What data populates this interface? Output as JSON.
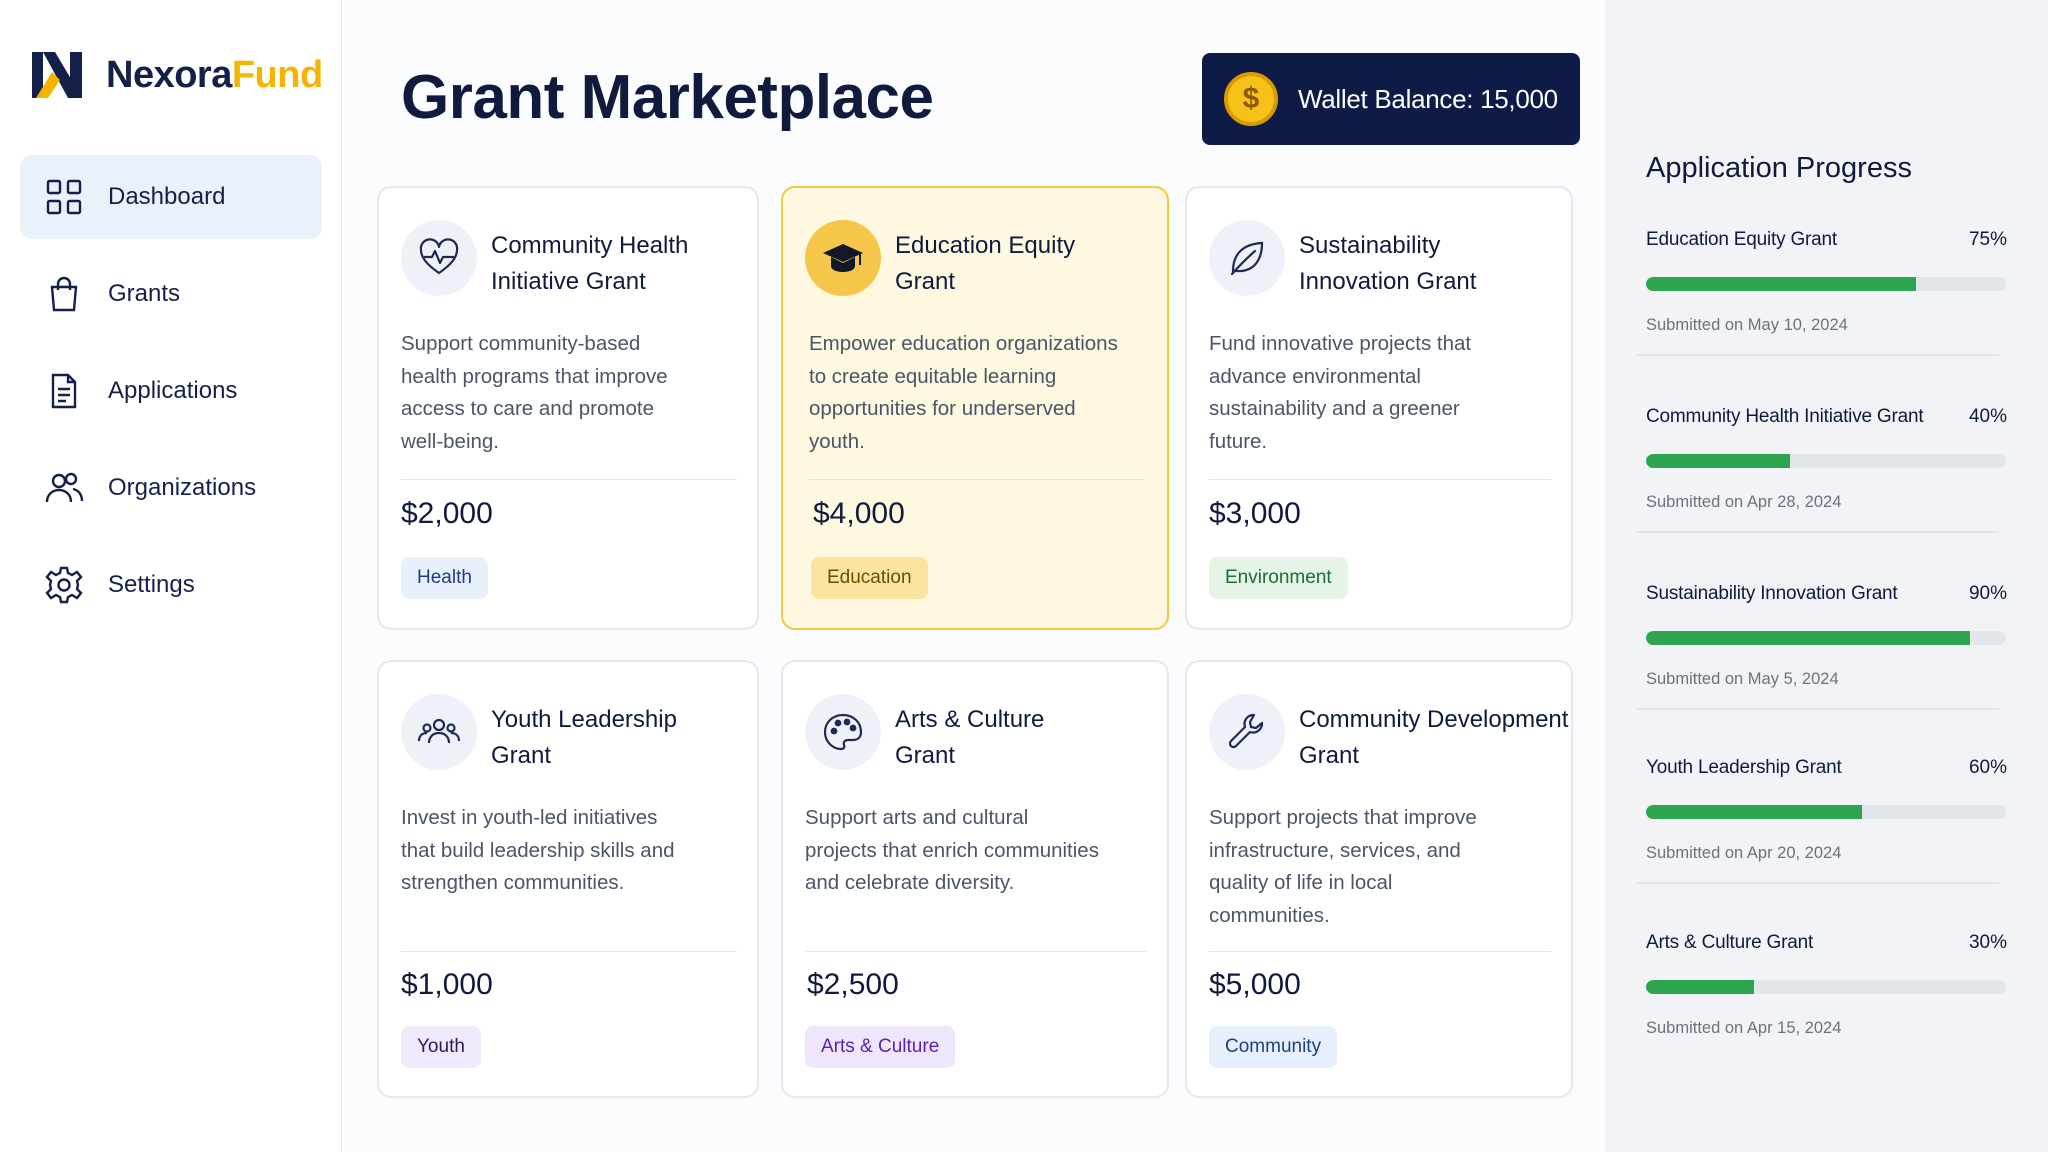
{
  "brand": {
    "name_part1": "Nexora",
    "name_part2": "Fund",
    "accent": "#f5b400",
    "primary": "#13204a"
  },
  "nav": [
    {
      "label": "Dashboard",
      "icon": "grid-icon",
      "active": true
    },
    {
      "label": "Grants",
      "icon": "shopping-bag-icon",
      "active": false
    },
    {
      "label": "Applications",
      "icon": "document-icon",
      "active": false
    },
    {
      "label": "Organizations",
      "icon": "users-icon",
      "active": false
    },
    {
      "label": "Settings",
      "icon": "gear-icon",
      "active": false
    }
  ],
  "header": {
    "title": "Grant Marketplace"
  },
  "wallet": {
    "coin_symbol": "$",
    "label": "Wallet Balance: 15,000"
  },
  "grants": [
    {
      "title_line1": "Community Health",
      "title_line2": "Initiative Grant",
      "icon": "heart-pulse-icon",
      "desc": [
        "Support community-based",
        "health programs that improve",
        "access to care and promote",
        "well-being."
      ],
      "amount": "$2,000",
      "tag": "Health",
      "tag_bg": "#e8f0fc",
      "tag_fg": "#1e3a8a",
      "featured": false
    },
    {
      "title_line1": "Education Equity",
      "title_line2": "Grant",
      "icon": "graduation-cap-icon",
      "desc": [
        "Empower education organizations",
        "to create equitable learning",
        "opportunities for underserved",
        "youth."
      ],
      "amount": "$4,000",
      "tag": "Education",
      "tag_bg": "#fbe6a6",
      "tag_fg": "#6b4e00",
      "featured": true
    },
    {
      "title_line1": "Sustainability",
      "title_line2": "Innovation Grant",
      "icon": "leaf-icon",
      "desc": [
        "Fund innovative projects that",
        "advance environmental",
        "sustainability and a greener",
        "future."
      ],
      "amount": "$3,000",
      "tag": "Environment",
      "tag_bg": "#e4f5e7",
      "tag_fg": "#1f6b33",
      "featured": false
    },
    {
      "title_line1": "Youth Leadership",
      "title_line2": "Grant",
      "icon": "group-icon",
      "desc": [
        "Invest in youth-led initiatives",
        "that build leadership skills and",
        "strengthen communities."
      ],
      "amount": "$1,000",
      "tag": "Youth",
      "tag_bg": "#efe9fb",
      "tag_fg": "#2b1d57",
      "featured": false
    },
    {
      "title_line1": "Arts & Culture",
      "title_line2": "Grant",
      "icon": "palette-icon",
      "desc": [
        "Support arts and cultural",
        "projects that enrich communities",
        "and celebrate diversity."
      ],
      "amount": "$2,500",
      "tag": "Arts & Culture",
      "tag_bg": "#f0e6fb",
      "tag_fg": "#5b21b6",
      "featured": false
    },
    {
      "title_line1": "Community Development",
      "title_line2": "Grant",
      "icon": "wrench-icon",
      "desc": [
        "Support projects that improve",
        "infrastructure, services, and",
        "quality of life in local",
        "communities."
      ],
      "amount": "$5,000",
      "tag": "Community",
      "tag_bg": "#e6effb",
      "tag_fg": "#1d3f8a",
      "featured": false
    }
  ],
  "progress": {
    "title": "Application Progress",
    "items": [
      {
        "name": "Education Equity Grant",
        "pct_label": "75%",
        "fraction": 0.75,
        "date": "Submitted on May 10, 2024"
      },
      {
        "name": "Community Health Initiative Grant",
        "pct_label": "40%",
        "fraction": 0.4,
        "date": "Submitted on Apr 28, 2024"
      },
      {
        "name": "Sustainability Innovation Grant",
        "pct_label": "90%",
        "fraction": 0.9,
        "date": "Submitted on May 5, 2024"
      },
      {
        "name": "Youth Leadership Grant",
        "pct_label": "60%",
        "fraction": 0.6,
        "date": "Submitted on Apr 20, 2024"
      },
      {
        "name": "Arts & Culture Grant",
        "pct_label": "30%",
        "fraction": 0.3,
        "date": "Submitted on Apr 15, 2024"
      }
    ]
  }
}
